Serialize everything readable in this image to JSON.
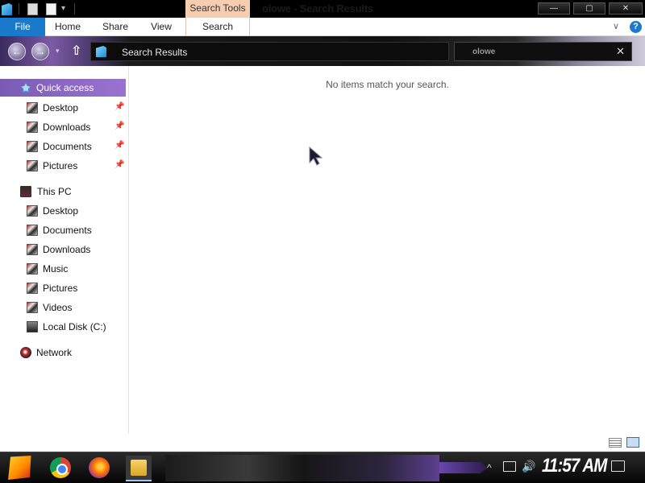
{
  "titlebar": {
    "title": "olowe - Search Results",
    "context_tab": "Search Tools",
    "minimize_glyph": "—",
    "maximize_glyph": "▢",
    "close_glyph": "✕"
  },
  "ribbon": {
    "tabs": [
      {
        "label": "File"
      },
      {
        "label": "Home"
      },
      {
        "label": "Share"
      },
      {
        "label": "View"
      },
      {
        "label": "Search"
      }
    ],
    "expand_glyph": "∨",
    "help_glyph": "?"
  },
  "navigation": {
    "back_glyph": "←",
    "forward_glyph": "→",
    "recent_glyph": "▾",
    "up_glyph": "⇧",
    "address": "Search Results",
    "search_value": "olowe",
    "search_clear_glyph": "✕"
  },
  "sidebar": {
    "quick_access": {
      "label": "Quick access",
      "items": [
        {
          "label": "Desktop",
          "pinned": true
        },
        {
          "label": "Downloads",
          "pinned": true
        },
        {
          "label": "Documents",
          "pinned": true
        },
        {
          "label": "Pictures",
          "pinned": true
        }
      ]
    },
    "this_pc": {
      "label": "This PC",
      "items": [
        {
          "label": "Desktop"
        },
        {
          "label": "Documents"
        },
        {
          "label": "Downloads"
        },
        {
          "label": "Music"
        },
        {
          "label": "Pictures"
        },
        {
          "label": "Videos"
        },
        {
          "label": "Local Disk (C:)"
        }
      ]
    },
    "network": {
      "label": "Network"
    },
    "pin_glyph": "📌"
  },
  "content": {
    "empty_message": "No items match your search."
  },
  "taskbar": {
    "clock": "11:57 AM",
    "tray_up_glyph": "^",
    "volume_glyph": "🔊"
  },
  "colors": {
    "accent_file_tab": "#1979ca",
    "context_tab": "#f7cdb1",
    "selection": "#8a66c2"
  }
}
